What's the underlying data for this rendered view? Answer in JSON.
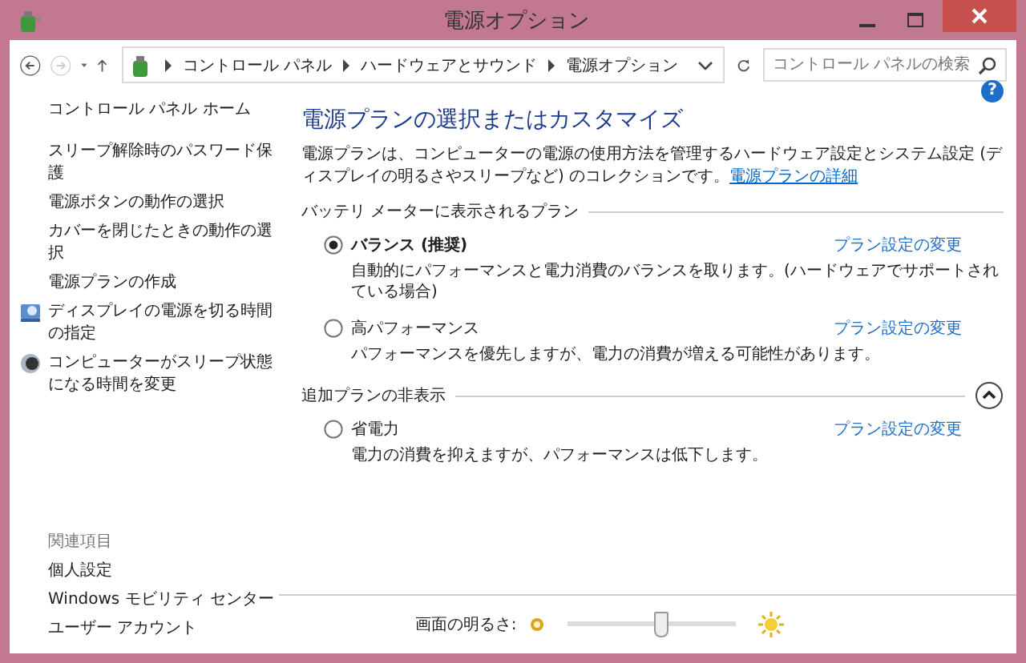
{
  "window": {
    "title": "電源オプション"
  },
  "address_bar": {
    "path": [
      "コントロール パネル",
      "ハードウェアとサウンド",
      "電源オプション"
    ]
  },
  "search": {
    "placeholder": "コントロール パネルの検索"
  },
  "help_button": "?",
  "sidebar": {
    "home": "コントロール パネル ホーム",
    "items": [
      {
        "label": "スリープ解除時のパスワード保護",
        "kind": "plain"
      },
      {
        "label": "電源ボタンの動作の選択",
        "kind": "plain"
      },
      {
        "label": "カバーを閉じたときの動作の選択",
        "kind": "plain"
      },
      {
        "label": "電源プランの作成",
        "kind": "plain"
      },
      {
        "label": "ディスプレイの電源を切る時間の指定",
        "kind": "display"
      },
      {
        "label": "コンピューターがスリープ状態になる時間を変更",
        "kind": "sleep"
      }
    ],
    "related_title": "関連項目",
    "related": [
      "個人設定",
      "Windows モビリティ センター",
      "ユーザー アカウント"
    ]
  },
  "main": {
    "heading": "電源プランの選択またはカスタマイズ",
    "description": "電源プランは、コンピューターの電源の使用方法を管理するハードウェア設定とシステム設定 (ディスプレイの明るさやスリープなど) のコレクションです。",
    "description_link": "電源プランの詳細",
    "groups": [
      {
        "title": "バッテリ メーターに表示されるプラン",
        "collapsible": false,
        "plans": [
          {
            "name": "バランス (推奨)",
            "selected": true,
            "description": "自動的にパフォーマンスと電力消費のバランスを取ります。(ハードウェアでサポートされている場合)",
            "link": "プラン設定の変更"
          },
          {
            "name": "高パフォーマンス",
            "selected": false,
            "description": "パフォーマンスを優先しますが、電力の消費が増える可能性があります。",
            "link": "プラン設定の変更"
          }
        ]
      },
      {
        "title": "追加プランの非表示",
        "collapsible": true,
        "expanded": true,
        "plans": [
          {
            "name": "省電力",
            "selected": false,
            "description": "電力の消費を抑えますが、パフォーマンスは低下します。",
            "link": "プラン設定の変更"
          }
        ]
      }
    ]
  },
  "brightness": {
    "label": "画面の明るさ:",
    "level": 0.56
  }
}
